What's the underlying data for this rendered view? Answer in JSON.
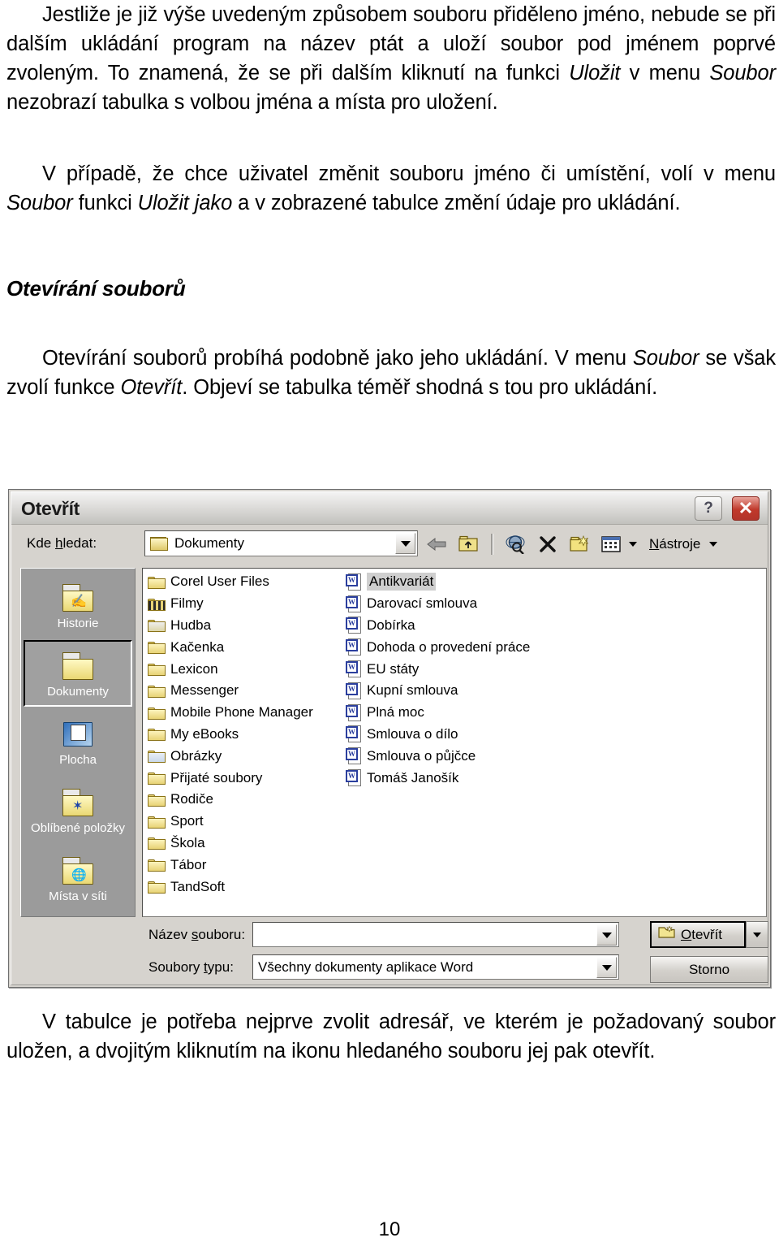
{
  "document": {
    "paragraph1_html": "Jestliže je již výše uvedeným způsobem souboru přiděleno jméno, nebude se při dalším ukládání program na název ptát a uloží soubor pod jménem poprvé zvoleným. To znamená, že se při dalším kliknutí na funkci <em>Uložit</em> v menu <em>Soubor</em> nezobrazí tabulka s volbou jména a místa pro uložení.",
    "paragraph2_html": "V případě, že chce uživatel změnit souboru jméno či umístění, volí v menu <em>Soubor</em> funkci <em>Uložit jako</em> a v zobrazené tabulce změní údaje pro ukládání.",
    "heading": "Otevírání souborů",
    "paragraph3_html": "Otevírání souborů probíhá podobně jako jeho ukládání. V menu <em>Soubor</em> se však zvolí funkce <em>Otevřít</em>. Objeví se tabulka téměř shodná s tou pro ukládání.",
    "paragraph4_html": "V tabulce je potřeba nejprve zvolit adresář, ve kterém je požadovaný soubor uložen, a dvojitým kliknutím na ikonu hledaného souboru jej pak otevřít.",
    "page_number": "10"
  },
  "dialog": {
    "title": "Otevřít",
    "titlebar_buttons": {
      "help": "?",
      "close": "✕"
    },
    "look_in": {
      "label": "Kde hledat:",
      "label_prefix": "Kde ",
      "label_accel": "h",
      "label_suffix": "ledat:",
      "value": "Dokumenty",
      "icon": "open-folder-icon"
    },
    "toolbar": {
      "items": [
        {
          "name": "back-icon",
          "glyph": "⬅",
          "label": ""
        },
        {
          "name": "up-one-level-icon",
          "glyph": "⬆",
          "label": ""
        },
        {
          "name": "search-web-icon",
          "glyph": "🔍",
          "label": ""
        },
        {
          "name": "delete-icon",
          "glyph": "✕",
          "label": ""
        },
        {
          "name": "new-folder-icon",
          "glyph": "📁",
          "label": ""
        },
        {
          "name": "views-icon",
          "glyph": "▦",
          "label": ""
        }
      ],
      "tools_label": "Nástroje",
      "tools_accel": "N",
      "tools_rest": "ástroje"
    },
    "places": [
      {
        "label": "Historie",
        "icon": "history-folder-icon",
        "selected": false
      },
      {
        "label": "Dokumenty",
        "icon": "documents-folder-icon",
        "selected": true
      },
      {
        "label": "Plocha",
        "icon": "desktop-icon",
        "selected": false
      },
      {
        "label": "Oblíbené položky",
        "icon": "favorites-folder-icon",
        "selected": false
      },
      {
        "label": "Místa v síti",
        "icon": "network-places-icon",
        "selected": false
      }
    ],
    "file_list": {
      "column_a": [
        {
          "name": "Corel User Files",
          "type": "folder",
          "selected": false
        },
        {
          "name": "Filmy",
          "type": "folder-film",
          "selected": false
        },
        {
          "name": "Hudba",
          "type": "folder-music",
          "selected": false
        },
        {
          "name": "Kačenka",
          "type": "folder",
          "selected": false
        },
        {
          "name": "Lexicon",
          "type": "folder",
          "selected": false
        },
        {
          "name": "Messenger",
          "type": "folder",
          "selected": false
        },
        {
          "name": "Mobile Phone Manager",
          "type": "folder",
          "selected": false
        },
        {
          "name": "My eBooks",
          "type": "folder",
          "selected": false
        },
        {
          "name": "Obrázky",
          "type": "folder-pictures",
          "selected": false
        },
        {
          "name": "Přijaté soubory",
          "type": "folder",
          "selected": false
        },
        {
          "name": "Rodiče",
          "type": "folder",
          "selected": false
        },
        {
          "name": "Sport",
          "type": "folder",
          "selected": false
        },
        {
          "name": "Škola",
          "type": "folder",
          "selected": false
        },
        {
          "name": "Tábor",
          "type": "folder",
          "selected": false
        },
        {
          "name": "TandSoft",
          "type": "folder",
          "selected": false
        }
      ],
      "column_b": [
        {
          "name": "Antikvariát",
          "type": "word-document",
          "selected": true
        },
        {
          "name": "Darovací smlouva",
          "type": "word-document",
          "selected": false
        },
        {
          "name": "Dobírka",
          "type": "word-document",
          "selected": false
        },
        {
          "name": "Dohoda o provedení práce",
          "type": "word-document",
          "selected": false
        },
        {
          "name": "EU státy",
          "type": "word-document",
          "selected": false
        },
        {
          "name": "Kupní smlouva",
          "type": "word-document",
          "selected": false
        },
        {
          "name": "Plná moc",
          "type": "word-document",
          "selected": false
        },
        {
          "name": "Smlouva o dílo",
          "type": "word-document",
          "selected": false
        },
        {
          "name": "Smlouva o půjčce",
          "type": "word-document",
          "selected": false
        },
        {
          "name": "Tomáš Janošík",
          "type": "word-document",
          "selected": false
        }
      ]
    },
    "file_name": {
      "label": "Název souboru:",
      "label_prefix": "Název ",
      "label_accel": "s",
      "label_suffix": "ouboru:",
      "value": ""
    },
    "file_type": {
      "label": "Soubory typu:",
      "label_prefix": "Soubory ",
      "label_accel": "t",
      "label_suffix": "ypu:",
      "value": "Všechny dokumenty aplikace Word"
    },
    "buttons": {
      "open": "Otevřít",
      "open_accel": "O",
      "open_rest": "tevřít",
      "cancel": "Storno"
    }
  },
  "colors": {
    "dialog_face": "#d6d3ce",
    "places_bar": "#9b9b9b",
    "close_button": "#c0392b",
    "selection": "#cfcfcf",
    "word_blue": "#2b3f9e",
    "folder_yellow": "#e8d375"
  }
}
